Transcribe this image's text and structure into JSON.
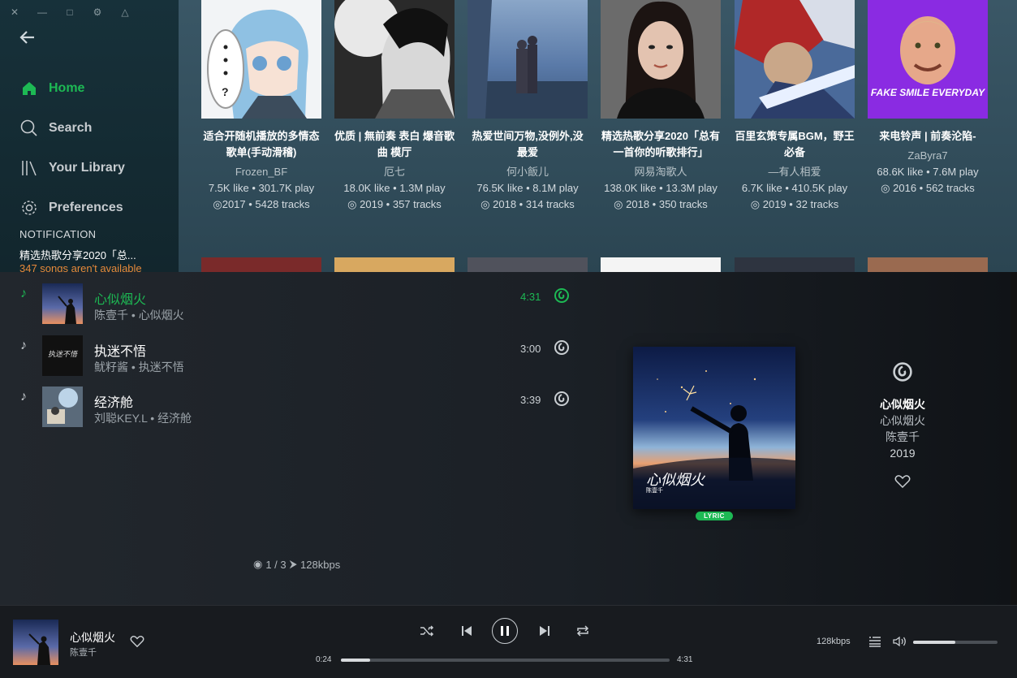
{
  "sidebar": {
    "nav": [
      {
        "label": "Home",
        "icon": "home-icon"
      },
      {
        "label": "Search",
        "icon": "search-icon"
      },
      {
        "label": "Your Library",
        "icon": "library-icon"
      },
      {
        "label": "Preferences",
        "icon": "gear-icon"
      }
    ],
    "notification_title": "NOTIFICATION",
    "notification_text": "精选热歌分享2020「总...",
    "notification_sub": "347 songs aren't available"
  },
  "playlists": [
    {
      "title": "适合开随机播放的多情态歌单(手动滑稽)",
      "owner": "Frozen_BF",
      "stats": "7.5K like • 301.7K play",
      "meta": "2017 • 5428 tracks"
    },
    {
      "title": "优质 | 無前奏 表白 爆音歌曲 模厅",
      "owner": "厄七",
      "stats": "18.0K like • 1.3M play",
      "meta": "2019 • 357 tracks"
    },
    {
      "title": "热爱世间万物,没例外,没最爱",
      "owner": "何小飯儿",
      "stats": "76.5K like • 8.1M play",
      "meta": "2018 • 314 tracks"
    },
    {
      "title": "精选热歌分享2020「总有一首你的听歌排行」",
      "owner": "网易淘歌人",
      "stats": "138.0K like • 13.3M play",
      "meta": "2018 • 350 tracks"
    },
    {
      "title": "百里玄策专属BGM，野王必备",
      "owner": "—有人相爱",
      "stats": "6.7K like • 410.5K play",
      "meta": "2019 • 32 tracks"
    },
    {
      "title": "来电铃声 | 前奏沦陷-",
      "owner": "ZaByra7",
      "stats": "68.6K like • 7.6M play",
      "meta": "2016 • 562 tracks"
    }
  ],
  "cover6_text": "FAKE SMILE EVERYDAY",
  "tracks": [
    {
      "name": "心似烟火",
      "artist": "陈壹千",
      "album": "心似烟火",
      "duration": "4:31"
    },
    {
      "name": "执迷不悟",
      "artist": "鱿籽酱",
      "album": "执迷不悟",
      "duration": "3:00"
    },
    {
      "name": "经济舱",
      "artist": "刘聪KEY.L",
      "album": "经济舱",
      "duration": "3:39"
    }
  ],
  "track_sep": "•",
  "status": {
    "position": "1 / 3",
    "quality": "128kbps"
  },
  "cover_art": {
    "lettering": "心似烟火",
    "artist": "陈壹千"
  },
  "cover2_lettering": "执迷不悟",
  "lyric_badge": "LYRIC",
  "info": {
    "title": "心似烟火",
    "album": "心似烟火",
    "artist": "陈壹千",
    "year": "2019"
  },
  "player": {
    "title": "心似烟火",
    "artist": "陈壹千",
    "elapsed": "0:24",
    "total": "4:31",
    "progress_fraction": 0.09,
    "quality": "128kbps",
    "volume_fraction": 0.5
  },
  "colors": {
    "accent": "#1db954",
    "notification": "#e8893a"
  }
}
